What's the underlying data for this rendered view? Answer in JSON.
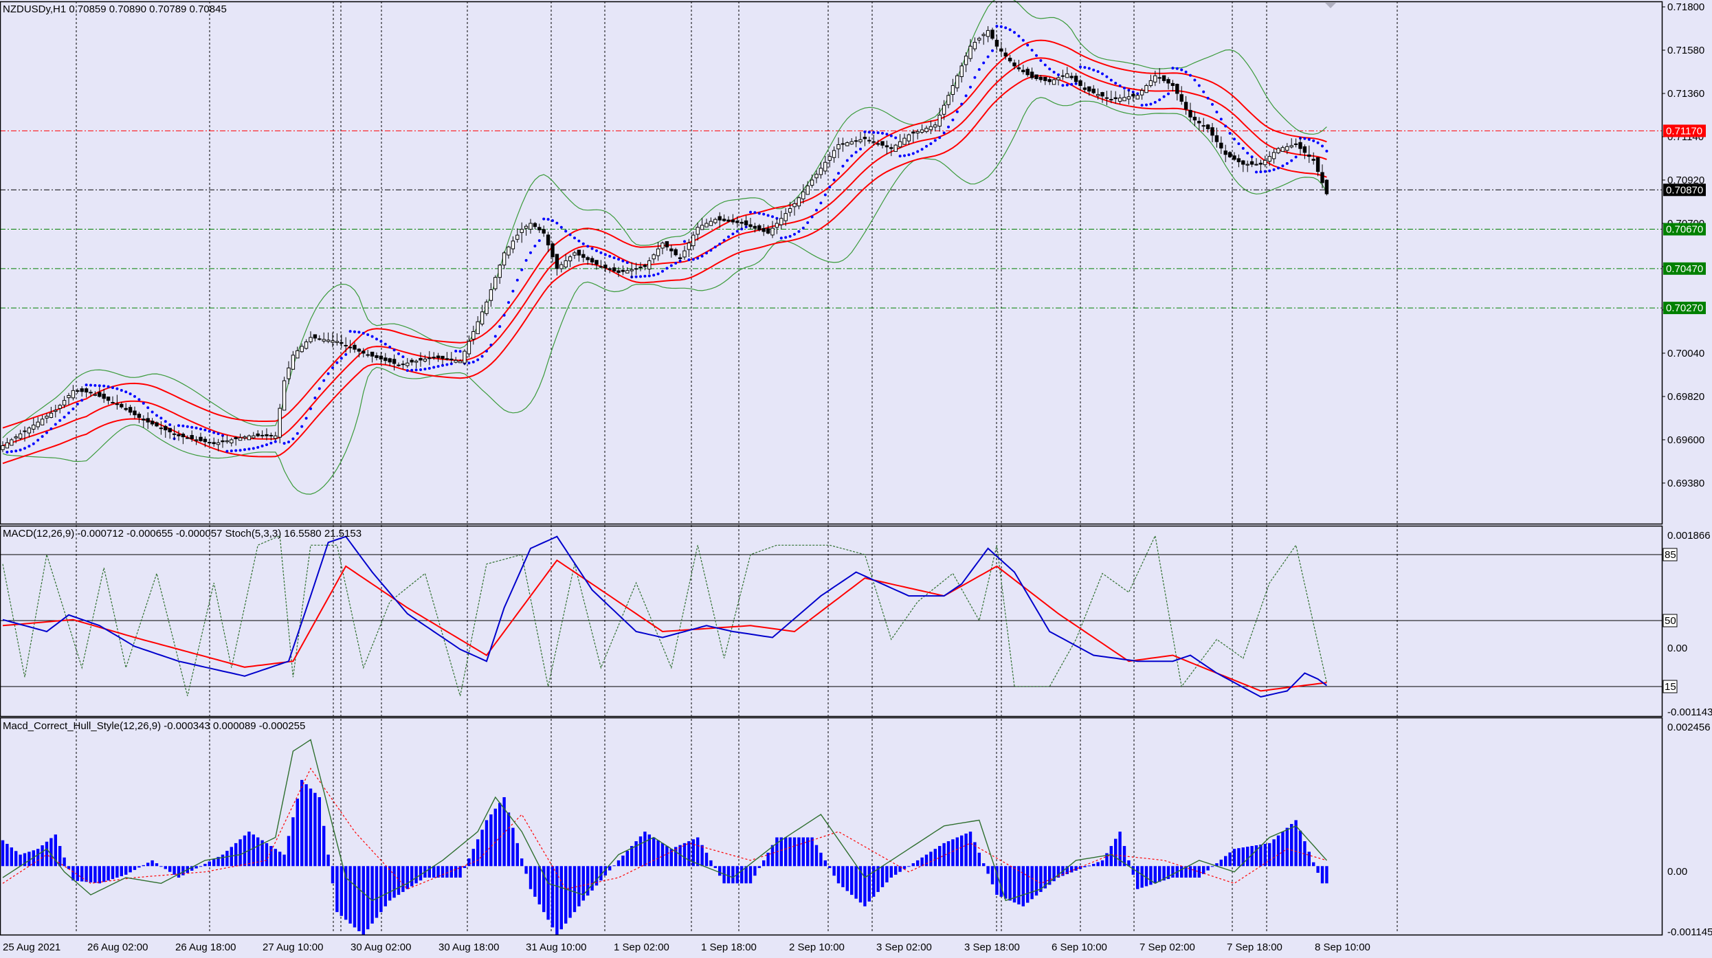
{
  "header": {
    "symbol_line": "NZDUSDy,H1  0.70859 0.70890 0.70789 0.70845",
    "macd_line": "MACD(12,26,9) -0.000712 -0.000655 -0.000057  Stoch(5,3,3) 16.5580 21.5153",
    "hull_line": "Macd_Correct_Hull_Style(12,26,9) -0.000343 0.000089 -0.000255"
  },
  "colors": {
    "background": "#e6e6f8",
    "grid": "#000000",
    "bollinger": "#3a9a3a",
    "envelope": "#ff0000",
    "sar": "#0000ff",
    "macd_main": "#0000cc",
    "macd_signal": "#ff0000",
    "stoch": "#2f6f2f",
    "hist": "#0000ff"
  },
  "chart_data": [
    {
      "type": "candlestick",
      "panel": "price",
      "symbol": "NZDUSDy",
      "timeframe": "H1",
      "ohlc_current": {
        "open": 0.70859,
        "high": 0.7089,
        "low": 0.70789,
        "close": 0.70845
      },
      "ylim": [
        0.6924,
        0.718
      ],
      "y_ticks": [
        "0.71800",
        "0.71580",
        "0.71360",
        "0.71140",
        "0.70920",
        "0.70700",
        "0.70480",
        "0.70260",
        "0.70040",
        "0.69820",
        "0.69600",
        "0.69380"
      ],
      "x_ticks": [
        "25 Aug 2021",
        "26 Aug 02:00",
        "26 Aug 18:00",
        "27 Aug 10:00",
        "30 Aug 02:00",
        "30 Aug 18:00",
        "31 Aug 10:00",
        "1 Sep 02:00",
        "1 Sep 18:00",
        "2 Sep 10:00",
        "3 Sep 02:00",
        "3 Sep 18:00",
        "6 Sep 10:00",
        "7 Sep 02:00",
        "7 Sep 18:00",
        "8 Sep 10:00"
      ],
      "horizontal_levels": [
        {
          "value": 0.7117,
          "label": "0.71170",
          "color": "#ff0000",
          "style": "dashdot"
        },
        {
          "value": 0.7087,
          "label": "0.70870",
          "color": "#000000",
          "style": "dashdot"
        },
        {
          "value": 0.7067,
          "label": "0.70670",
          "color": "#008000",
          "style": "dashdot"
        },
        {
          "value": 0.7047,
          "label": "0.70470",
          "color": "#008000",
          "style": "dashdot"
        },
        {
          "value": 0.7027,
          "label": "0.70270",
          "color": "#008000",
          "style": "dashdot"
        }
      ],
      "close_anchors": [
        [
          0,
          0.6957
        ],
        [
          6,
          0.6966
        ],
        [
          12,
          0.6975
        ],
        [
          16,
          0.6985
        ],
        [
          20,
          0.6984
        ],
        [
          26,
          0.6978
        ],
        [
          32,
          0.697
        ],
        [
          40,
          0.6962
        ],
        [
          48,
          0.6958
        ],
        [
          56,
          0.6962
        ],
        [
          62,
          0.6962
        ],
        [
          64,
          0.699
        ],
        [
          66,
          0.7003
        ],
        [
          70,
          0.7012
        ],
        [
          76,
          0.701
        ],
        [
          82,
          0.7004
        ],
        [
          90,
          0.6998
        ],
        [
          98,
          0.7002
        ],
        [
          104,
          0.7
        ],
        [
          106,
          0.701
        ],
        [
          110,
          0.703
        ],
        [
          114,
          0.7055
        ],
        [
          118,
          0.7067
        ],
        [
          120,
          0.707
        ],
        [
          123,
          0.7065
        ],
        [
          126,
          0.7047
        ],
        [
          130,
          0.7055
        ],
        [
          136,
          0.7048
        ],
        [
          140,
          0.7045
        ],
        [
          146,
          0.7048
        ],
        [
          150,
          0.706
        ],
        [
          154,
          0.7052
        ],
        [
          158,
          0.7068
        ],
        [
          162,
          0.7072
        ],
        [
          168,
          0.707
        ],
        [
          174,
          0.7065
        ],
        [
          180,
          0.708
        ],
        [
          186,
          0.7098
        ],
        [
          190,
          0.711
        ],
        [
          196,
          0.7113
        ],
        [
          202,
          0.7108
        ],
        [
          206,
          0.7115
        ],
        [
          212,
          0.712
        ],
        [
          216,
          0.714
        ],
        [
          220,
          0.716
        ],
        [
          224,
          0.7168
        ],
        [
          226,
          0.716
        ],
        [
          230,
          0.715
        ],
        [
          234,
          0.7144
        ],
        [
          238,
          0.7142
        ],
        [
          242,
          0.7146
        ],
        [
          246,
          0.7138
        ],
        [
          252,
          0.7133
        ],
        [
          258,
          0.7135
        ],
        [
          262,
          0.7145
        ],
        [
          266,
          0.714
        ],
        [
          270,
          0.7124
        ],
        [
          274,
          0.7118
        ],
        [
          278,
          0.7105
        ],
        [
          282,
          0.71
        ],
        [
          286,
          0.71
        ],
        [
          290,
          0.7108
        ],
        [
          294,
          0.711
        ],
        [
          298,
          0.7102
        ],
        [
          301,
          0.7085
        ]
      ]
    },
    {
      "type": "line",
      "panel": "macd_stoch",
      "indicator": "MACD(12,26,9) + Stoch(5,3,3)",
      "values": {
        "macd_main": -0.000712,
        "macd_signal": -0.000655,
        "macd_hist": -5.7e-05,
        "stoch_k": 16.558,
        "stoch_d": 21.5153
      },
      "ylim": [
        -0.001143,
        0.001866
      ],
      "y_ticks": [
        "0.001866",
        "0.00",
        "-0.001143"
      ],
      "stoch_levels": [
        85,
        50,
        15
      ],
      "macd_main_anchors": [
        [
          0,
          0.0004
        ],
        [
          10,
          0.0002
        ],
        [
          15,
          0.00048
        ],
        [
          22,
          0.0003
        ],
        [
          30,
          -5e-05
        ],
        [
          40,
          -0.0003
        ],
        [
          55,
          -0.00055
        ],
        [
          65,
          -0.0003
        ],
        [
          70,
          0.0008
        ],
        [
          74,
          0.0017
        ],
        [
          78,
          0.0018
        ],
        [
          84,
          0.0012
        ],
        [
          92,
          0.0005
        ],
        [
          104,
          -0.0001
        ],
        [
          110,
          -0.0003
        ],
        [
          114,
          0.0006
        ],
        [
          120,
          0.0016
        ],
        [
          126,
          0.0018
        ],
        [
          134,
          0.0009
        ],
        [
          144,
          0.0002
        ],
        [
          150,
          0.0001
        ],
        [
          160,
          0.0003
        ],
        [
          166,
          0.0002
        ],
        [
          175,
          0.0001
        ],
        [
          186,
          0.0008
        ],
        [
          194,
          0.0012
        ],
        [
          206,
          0.0008
        ],
        [
          214,
          0.0008
        ],
        [
          218,
          0.001
        ],
        [
          224,
          0.0016
        ],
        [
          230,
          0.0012
        ],
        [
          238,
          0.0002
        ],
        [
          248,
          -0.0002
        ],
        [
          258,
          -0.0003
        ],
        [
          266,
          -0.0003
        ],
        [
          270,
          -0.0002
        ],
        [
          276,
          -0.0005
        ],
        [
          286,
          -0.0009
        ],
        [
          292,
          -0.0008
        ],
        [
          296,
          -0.0005
        ],
        [
          299,
          -0.0006
        ],
        [
          301,
          -0.00071
        ]
      ],
      "macd_signal_anchors": [
        [
          0,
          0.0003
        ],
        [
          16,
          0.0004
        ],
        [
          30,
          0.0001
        ],
        [
          55,
          -0.0004
        ],
        [
          66,
          -0.0003
        ],
        [
          78,
          0.0013
        ],
        [
          92,
          0.0006
        ],
        [
          110,
          -0.0002
        ],
        [
          126,
          0.0014
        ],
        [
          150,
          0.0002
        ],
        [
          170,
          0.0003
        ],
        [
          180,
          0.0002
        ],
        [
          196,
          0.0011
        ],
        [
          214,
          0.0008
        ],
        [
          226,
          0.0013
        ],
        [
          240,
          0.0005
        ],
        [
          256,
          -0.0003
        ],
        [
          266,
          -0.0002
        ],
        [
          286,
          -0.0008
        ],
        [
          301,
          -0.00066
        ]
      ],
      "stoch_anchors": [
        [
          0,
          80
        ],
        [
          5,
          20
        ],
        [
          10,
          85
        ],
        [
          18,
          25
        ],
        [
          23,
          78
        ],
        [
          28,
          25
        ],
        [
          35,
          75
        ],
        [
          42,
          10
        ],
        [
          48,
          70
        ],
        [
          52,
          25
        ],
        [
          58,
          90
        ],
        [
          63,
          95
        ],
        [
          66,
          20
        ],
        [
          70,
          90
        ],
        [
          76,
          90
        ],
        [
          82,
          25
        ],
        [
          88,
          60
        ],
        [
          96,
          75
        ],
        [
          104,
          10
        ],
        [
          110,
          80
        ],
        [
          118,
          85
        ],
        [
          124,
          15
        ],
        [
          130,
          80
        ],
        [
          136,
          25
        ],
        [
          144,
          70
        ],
        [
          152,
          25
        ],
        [
          158,
          90
        ],
        [
          164,
          30
        ],
        [
          170,
          85
        ],
        [
          176,
          90
        ],
        [
          182,
          90
        ],
        [
          188,
          90
        ],
        [
          196,
          85
        ],
        [
          202,
          40
        ],
        [
          208,
          60
        ],
        [
          216,
          75
        ],
        [
          222,
          50
        ],
        [
          226,
          90
        ],
        [
          230,
          15
        ],
        [
          238,
          15
        ],
        [
          244,
          40
        ],
        [
          250,
          75
        ],
        [
          256,
          65
        ],
        [
          262,
          95
        ],
        [
          268,
          15
        ],
        [
          276,
          40
        ],
        [
          282,
          30
        ],
        [
          288,
          70
        ],
        [
          294,
          90
        ],
        [
          301,
          17
        ]
      ]
    },
    {
      "type": "bar",
      "panel": "hull",
      "indicator": "Macd_Correct_Hull_Style(12,26,9)",
      "values": {
        "main": -0.000343,
        "signal": 8.9e-05,
        "hist": -0.000255
      },
      "ylim": [
        -0.001145,
        0.002456
      ],
      "y_ticks": [
        "0.002456",
        "0.00",
        "-0.001145"
      ],
      "hist_anchors": [
        [
          0,
          0.00045
        ],
        [
          4,
          0.0002
        ],
        [
          8,
          0.0003
        ],
        [
          12,
          0.00055
        ],
        [
          16,
          -0.00025
        ],
        [
          22,
          -0.0003
        ],
        [
          28,
          -0.00015
        ],
        [
          34,
          0.0001
        ],
        [
          40,
          -0.0002
        ],
        [
          50,
          0.0002
        ],
        [
          56,
          0.0006
        ],
        [
          64,
          0.0002
        ],
        [
          68,
          0.0015
        ],
        [
          72,
          0.0012
        ],
        [
          76,
          -0.0008
        ],
        [
          82,
          -0.0012
        ],
        [
          88,
          -0.0006
        ],
        [
          96,
          -0.0002
        ],
        [
          104,
          -0.0002
        ],
        [
          110,
          0.0008
        ],
        [
          114,
          0.0012
        ],
        [
          120,
          -0.0004
        ],
        [
          126,
          -0.0012
        ],
        [
          132,
          -0.0006
        ],
        [
          140,
          0.0001
        ],
        [
          146,
          0.0006
        ],
        [
          152,
          0.0003
        ],
        [
          158,
          0.0005
        ],
        [
          164,
          -0.0003
        ],
        [
          170,
          -0.0003
        ],
        [
          176,
          0.0005
        ],
        [
          184,
          0.0005
        ],
        [
          190,
          -0.0003
        ],
        [
          196,
          -0.0007
        ],
        [
          202,
          -0.0002
        ],
        [
          208,
          0.0001
        ],
        [
          214,
          0.0004
        ],
        [
          220,
          0.0006
        ],
        [
          226,
          -0.0005
        ],
        [
          232,
          -0.0007
        ],
        [
          240,
          -0.0002
        ],
        [
          250,
          0.0001
        ],
        [
          254,
          0.0006
        ],
        [
          258,
          -0.0004
        ],
        [
          266,
          -0.0002
        ],
        [
          272,
          -0.0002
        ],
        [
          280,
          0.0003
        ],
        [
          288,
          0.0004
        ],
        [
          294,
          0.0008
        ],
        [
          300,
          -0.0003
        ],
        [
          301,
          -0.0003
        ]
      ],
      "hull_main_anchors": [
        [
          0,
          -0.0002
        ],
        [
          6,
          0.0001
        ],
        [
          10,
          0.0003
        ],
        [
          14,
          -0.0001
        ],
        [
          20,
          -0.0005
        ],
        [
          28,
          -0.0002
        ],
        [
          36,
          -0.0003
        ],
        [
          46,
          0.0001
        ],
        [
          54,
          0.0002
        ],
        [
          62,
          0.0005
        ],
        [
          66,
          0.002
        ],
        [
          70,
          0.0022
        ],
        [
          74,
          0.001
        ],
        [
          78,
          -0.0002
        ],
        [
          84,
          -0.0006
        ],
        [
          92,
          -0.0003
        ],
        [
          100,
          0.0001
        ],
        [
          108,
          0.0006
        ],
        [
          112,
          0.0012
        ],
        [
          118,
          0.0006
        ],
        [
          124,
          -0.0003
        ],
        [
          132,
          -0.0005
        ],
        [
          140,
          0.0002
        ],
        [
          148,
          0.0005
        ],
        [
          156,
          0.0001
        ],
        [
          166,
          -0.0002
        ],
        [
          176,
          0.0004
        ],
        [
          186,
          0.0009
        ],
        [
          196,
          -0.0002
        ],
        [
          206,
          0.0003
        ],
        [
          214,
          0.0007
        ],
        [
          222,
          0.0008
        ],
        [
          228,
          -0.0006
        ],
        [
          236,
          -0.0004
        ],
        [
          244,
          0.0001
        ],
        [
          252,
          0.0002
        ],
        [
          262,
          -0.0003
        ],
        [
          272,
          0.0001
        ],
        [
          280,
          -0.0001
        ],
        [
          288,
          0.0005
        ],
        [
          294,
          0.0007
        ],
        [
          301,
          0.0001
        ]
      ],
      "hull_signal_anchors": [
        [
          0,
          -0.0003
        ],
        [
          10,
          0.0002
        ],
        [
          20,
          -0.0003
        ],
        [
          30,
          -0.0002
        ],
        [
          46,
          -0.0001
        ],
        [
          60,
          0.0001
        ],
        [
          70,
          0.0017
        ],
        [
          80,
          0.0006
        ],
        [
          92,
          -0.0004
        ],
        [
          108,
          0.0001
        ],
        [
          118,
          0.0009
        ],
        [
          128,
          -0.0004
        ],
        [
          140,
          -0.0002
        ],
        [
          156,
          0.0004
        ],
        [
          170,
          0.0001
        ],
        [
          190,
          0.0006
        ],
        [
          206,
          -0.0001
        ],
        [
          220,
          0.0004
        ],
        [
          236,
          -0.0003
        ],
        [
          252,
          0.0002
        ],
        [
          264,
          0.0001
        ],
        [
          280,
          -0.0003
        ],
        [
          292,
          0.0003
        ],
        [
          301,
          0.0001
        ]
      ]
    }
  ]
}
